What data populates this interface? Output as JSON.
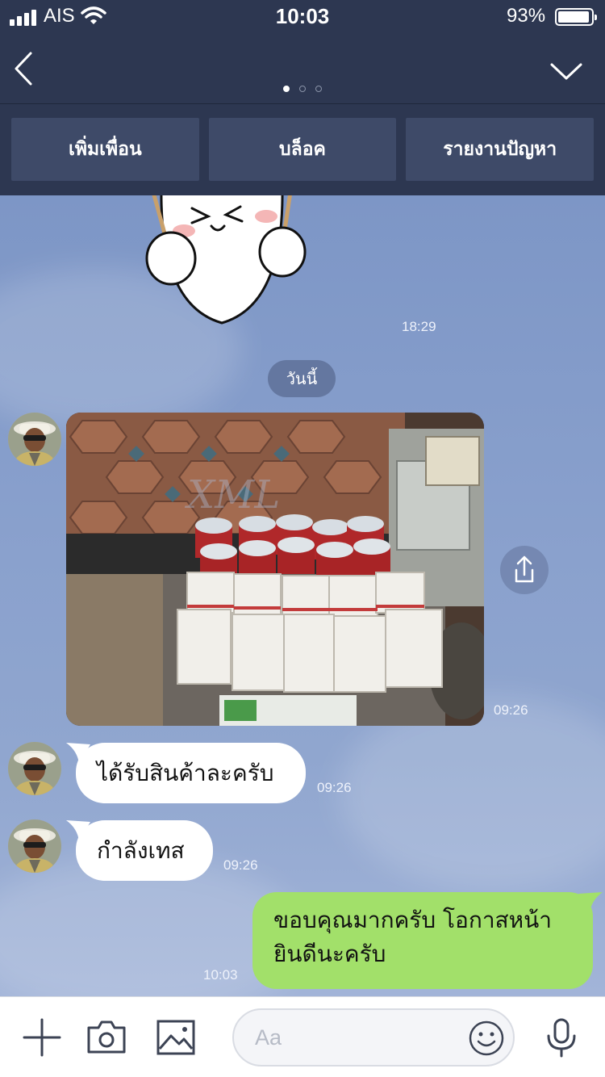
{
  "status_bar": {
    "carrier": "AIS",
    "time": "10:03",
    "battery_percent": "93%",
    "battery_level": 0.93
  },
  "header": {
    "page_index": 1,
    "page_count": 3,
    "actions": [
      {
        "label": "เพิ่มเพื่อน"
      },
      {
        "label": "บล็อค"
      },
      {
        "label": "รายงานปัญหา"
      }
    ]
  },
  "chat": {
    "sticker_time": "18:29",
    "date_separator": "วันนี้",
    "photo": {
      "watermark": "XML",
      "time": "09:26"
    },
    "messages": [
      {
        "text": "ได้รับสินค้าละครับ",
        "time": "09:26",
        "sender": "other"
      },
      {
        "text": "กำลังเทส",
        "time": "09:26",
        "sender": "other"
      },
      {
        "text_line1": "ขอบคุณมากครับ โอกาสหน้า",
        "text_line2": "ยินดีนะครับ",
        "time": "10:03",
        "sender": "me"
      }
    ]
  },
  "input_bar": {
    "placeholder": "Aa",
    "icons": [
      "plus-icon",
      "camera-icon",
      "image-icon",
      "emoji-icon",
      "microphone-icon"
    ]
  },
  "colors": {
    "header_bg": "#2d3751",
    "action_bg": "#3e4a68",
    "chat_bg": "#8aa1cd",
    "my_bubble": "#a2e06a",
    "their_bubble": "#ffffff"
  }
}
